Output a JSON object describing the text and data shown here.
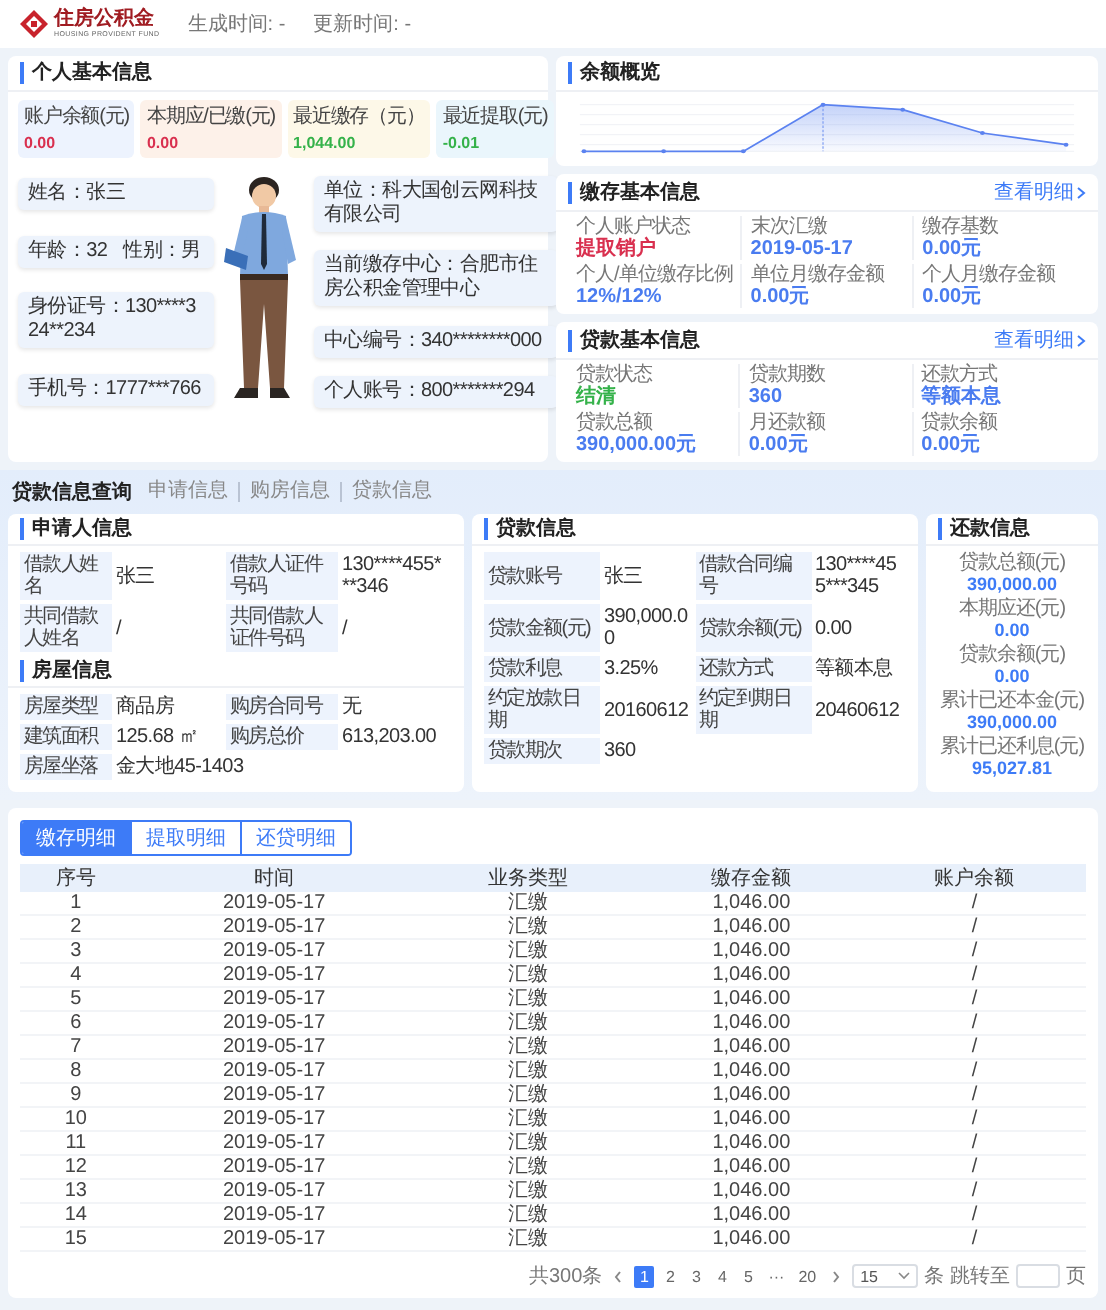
{
  "header": {
    "logo_title": "住房公积金",
    "logo_subtitle": "HOUSING PROVIDENT FUND",
    "generated_time": "生成时间: -",
    "updated_time": "更新时间: -"
  },
  "personal_info": {
    "title": "个人基本信息",
    "stats": [
      {
        "label": "账户余额(元)",
        "value": "0.00",
        "color": "#d9304f"
      },
      {
        "label": "本期应/已缴(元)",
        "value": "0.00",
        "color": "#d9304f"
      },
      {
        "label": "最近缴存（元）",
        "value": "1,044.00",
        "color": "#35b24a"
      },
      {
        "label": "最近提取(元)",
        "value": "-0.01",
        "color": "#35b24a"
      }
    ],
    "left_fields": [
      [
        "姓名：张三"
      ],
      [
        "年龄：32",
        "性别：男"
      ],
      [
        "身份证号：130****324**234"
      ],
      [
        "手机号：1777***766"
      ]
    ],
    "right_fields": [
      "单位：科大国创云网科技有限公司",
      "当前缴存中心：合肥市住房公积金管理中心",
      "中心编号：340********000",
      "个人账号：800*******294"
    ]
  },
  "balance_overview": {
    "title": "余额概览"
  },
  "deposit_info": {
    "title": "缴存基本信息",
    "link": "查看明细",
    "fields": [
      {
        "label": "个人账户状态",
        "value": "提取销户",
        "color": "#d9304f"
      },
      {
        "label": "末次汇缴",
        "value": "2019-05-17",
        "color": "#4a7cf0"
      },
      {
        "label": "缴存基数",
        "value": "0.00元",
        "color": "#4a7cf0"
      },
      {
        "label": "个人/单位缴存比例",
        "value": "12%/12%",
        "color": "#4a7cf0"
      },
      {
        "label": "单位月缴存金额",
        "value": "0.00元",
        "color": "#4a7cf0"
      },
      {
        "label": "个人月缴存金额",
        "value": "0.00元",
        "color": "#4a7cf0"
      }
    ]
  },
  "loan_summary": {
    "title": "贷款基本信息",
    "link": "查看明细",
    "fields": [
      {
        "label": "贷款状态",
        "value": "结清",
        "color": "#35b24a"
      },
      {
        "label": "贷款期数",
        "value": "360",
        "color": "#4a7cf0"
      },
      {
        "label": "还款方式",
        "value": "等额本息",
        "color": "#4a7cf0"
      },
      {
        "label": "贷款总额",
        "value": "390,000.00元",
        "color": "#4a7cf0"
      },
      {
        "label": "月还款额",
        "value": "0.00元",
        "color": "#4a7cf0"
      },
      {
        "label": "贷款余额",
        "value": "0.00元",
        "color": "#4a7cf0"
      }
    ]
  },
  "loan_query": {
    "title": "贷款信息查询",
    "nav": [
      "申请信息",
      "购房信息",
      "贷款信息"
    ],
    "applicant": {
      "title": "申请人信息",
      "fields": [
        {
          "label": "借款人姓名",
          "value": "张三"
        },
        {
          "label": "借款人证件号码",
          "value": "130****455***346"
        },
        {
          "label": "共同借款人姓名",
          "value": "/"
        },
        {
          "label": "共同借款人证件号码",
          "value": "/"
        }
      ]
    },
    "house": {
      "title": "房屋信息",
      "fields": [
        {
          "label": "房屋类型",
          "value": "商品房"
        },
        {
          "label": "购房合同号",
          "value": "无"
        },
        {
          "label": "建筑面积",
          "value": "125.68 ㎡"
        },
        {
          "label": "购房总价",
          "value": "613,203.00"
        },
        {
          "label": "房屋坐落",
          "value": "金大地45-1403"
        }
      ]
    },
    "loan": {
      "title": "贷款信息",
      "fields": [
        {
          "label": "贷款账号",
          "value": "张三"
        },
        {
          "label": "借款合同编号",
          "value": "130****455***345"
        },
        {
          "label": "贷款金额(元)",
          "value": "390,000.00"
        },
        {
          "label": "贷款余额(元)",
          "value": "0.00"
        },
        {
          "label": "贷款利息",
          "value": "3.25%"
        },
        {
          "label": "还款方式",
          "value": "等额本息"
        },
        {
          "label": "约定放款日期",
          "value": "20160612"
        },
        {
          "label": "约定到期日期",
          "value": "20460612"
        },
        {
          "label": "贷款期次",
          "value": "360"
        }
      ]
    },
    "repayment": {
      "title": "还款信息",
      "fields": [
        {
          "label": "贷款总额(元)",
          "value": "390,000.00"
        },
        {
          "label": "本期应还(元)",
          "value": "0.00"
        },
        {
          "label": "贷款余额(元)",
          "value": "0.00"
        },
        {
          "label": "累计已还本金(元)",
          "value": "390,000.00"
        },
        {
          "label": "累计已还利息(元)",
          "value": "95,027.81"
        }
      ]
    }
  },
  "details": {
    "tabs": [
      {
        "label": "缴存明细",
        "selected": true
      },
      {
        "label": "提取明细",
        "selected": false
      },
      {
        "label": "还贷明细",
        "selected": false
      }
    ],
    "columns": [
      "序号",
      "时间",
      "业务类型",
      "缴存金额",
      "账户余额"
    ],
    "rows": [
      [
        "1",
        "2019-05-17",
        "汇缴",
        "1,046.00",
        "/"
      ],
      [
        "2",
        "2019-05-17",
        "汇缴",
        "1,046.00",
        "/"
      ],
      [
        "3",
        "2019-05-17",
        "汇缴",
        "1,046.00",
        "/"
      ],
      [
        "4",
        "2019-05-17",
        "汇缴",
        "1,046.00",
        "/"
      ],
      [
        "5",
        "2019-05-17",
        "汇缴",
        "1,046.00",
        "/"
      ],
      [
        "6",
        "2019-05-17",
        "汇缴",
        "1,046.00",
        "/"
      ],
      [
        "7",
        "2019-05-17",
        "汇缴",
        "1,046.00",
        "/"
      ],
      [
        "8",
        "2019-05-17",
        "汇缴",
        "1,046.00",
        "/"
      ],
      [
        "9",
        "2019-05-17",
        "汇缴",
        "1,046.00",
        "/"
      ],
      [
        "10",
        "2019-05-17",
        "汇缴",
        "1,046.00",
        "/"
      ],
      [
        "11",
        "2019-05-17",
        "汇缴",
        "1,046.00",
        "/"
      ],
      [
        "12",
        "2019-05-17",
        "汇缴",
        "1,046.00",
        "/"
      ],
      [
        "13",
        "2019-05-17",
        "汇缴",
        "1,046.00",
        "/"
      ],
      [
        "14",
        "2019-05-17",
        "汇缴",
        "1,046.00",
        "/"
      ],
      [
        "15",
        "2019-05-17",
        "汇缴",
        "1,046.00",
        "/"
      ]
    ],
    "pagination": {
      "total": "共300条",
      "pages": [
        {
          "label": "1",
          "selected": true
        },
        {
          "label": "2",
          "selected": false
        },
        {
          "label": "3",
          "selected": false
        },
        {
          "label": "4",
          "selected": false
        },
        {
          "label": "5",
          "selected": false
        },
        {
          "label": "···",
          "selected": false
        },
        {
          "label": "20",
          "selected": false
        }
      ],
      "page_size": "15",
      "size_unit": "条",
      "jump_label": "跳转至",
      "page_unit": "页"
    }
  }
}
